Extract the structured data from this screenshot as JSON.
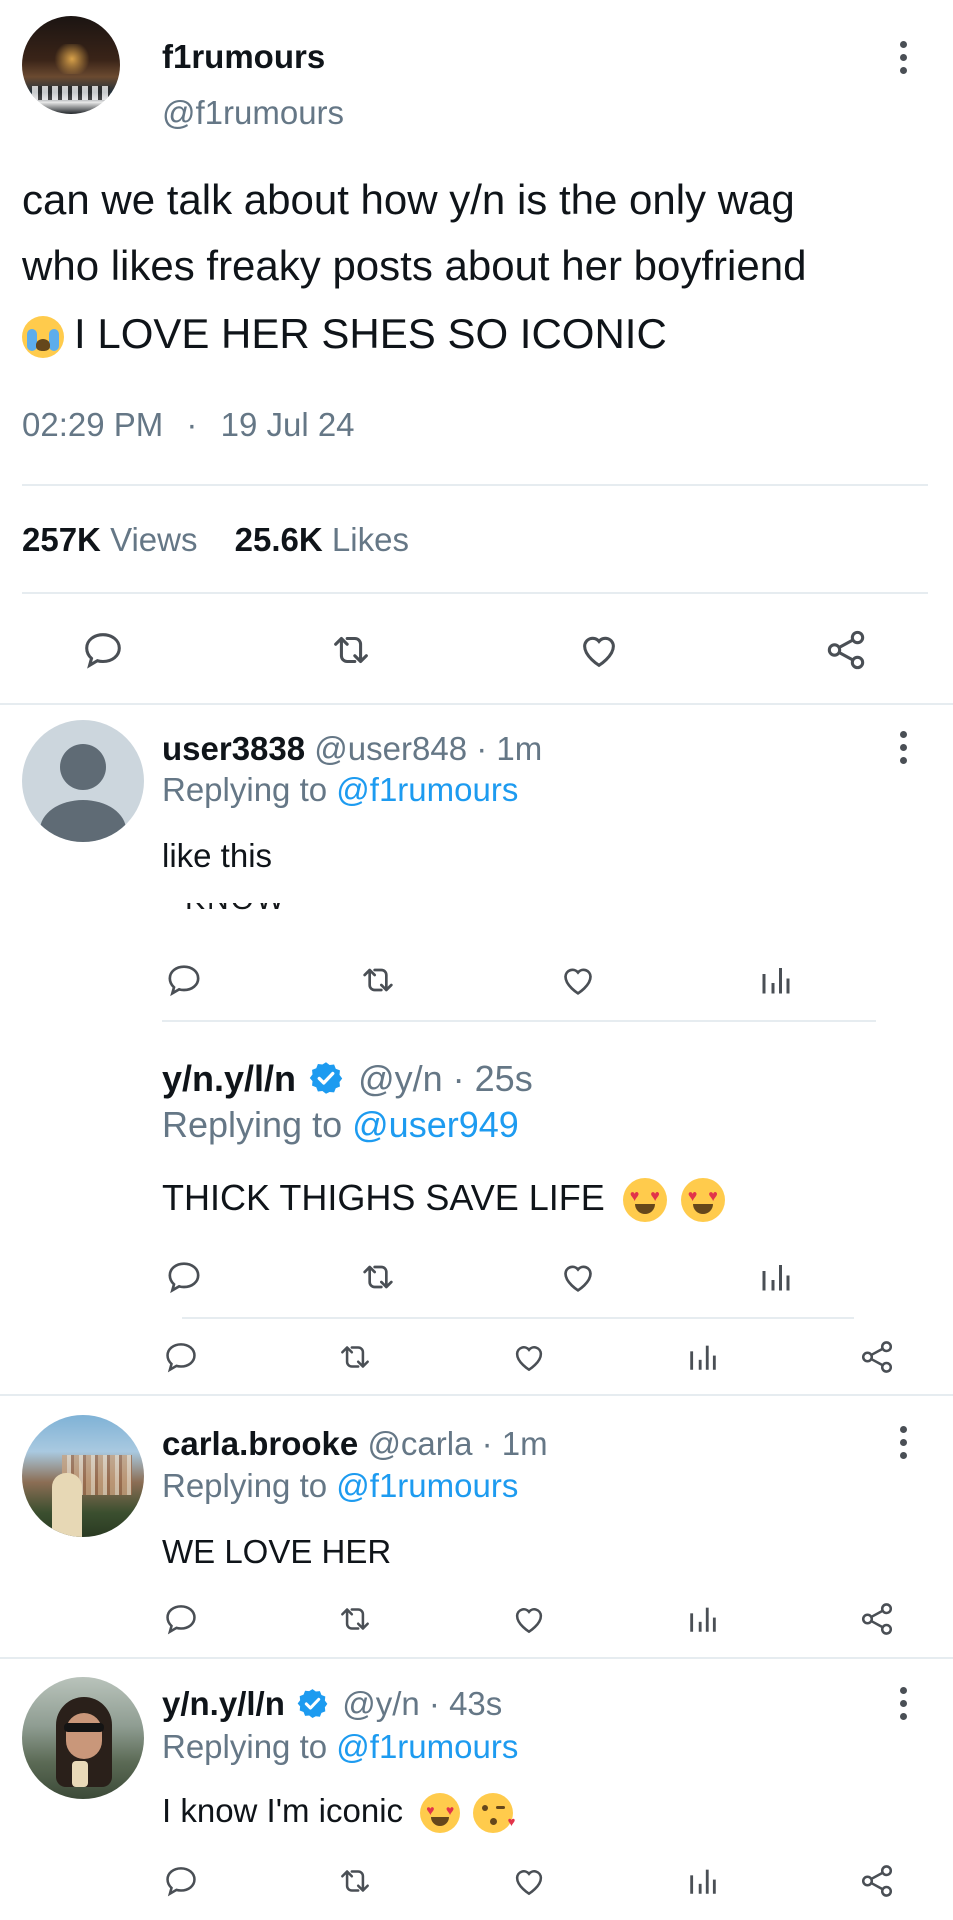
{
  "main_tweet": {
    "display_name": "f1rumours",
    "handle": "@f1rumours",
    "text_line1": "can we talk about how y/n is the only wag",
    "text_line2": "who likes freaky posts about her boyfriend",
    "text_line3": "I LOVE HER SHES SO ICONIC",
    "time": "02:29 PM",
    "separator": "·",
    "date": "19 Jul 24",
    "views_count": "257K",
    "views_label": "Views",
    "likes_count": "25.6K",
    "likes_label": "Likes"
  },
  "replies": [
    {
      "display_name": "user3838",
      "handle": "@user848",
      "meta": "· 1m",
      "replying_prefix": "Replying to",
      "replying_to": "@f1rumours",
      "text": "like this",
      "media_fragment": "KNOW"
    },
    {
      "display_name": "y/n.y/l/n",
      "handle": "@y/n",
      "meta": "· 25s",
      "replying_prefix": "Replying to",
      "replying_to": "@user949",
      "text": "THICK THIGHS SAVE LIFE"
    },
    {
      "display_name": "carla.brooke",
      "handle": "@carla",
      "meta": "· 1m",
      "replying_prefix": "Replying to",
      "replying_to": "@f1rumours",
      "text": "WE LOVE HER"
    },
    {
      "display_name": "y/n.y/l/n",
      "handle": "@y/n",
      "meta": "· 43s",
      "replying_prefix": "Replying to",
      "replying_to": "@f1rumours",
      "text": "I know I'm iconic"
    }
  ],
  "colors": {
    "link": "#1d9bf0",
    "muted": "#657786",
    "divider": "#e6ecf0",
    "verified": "#1d9bf0"
  },
  "icons": [
    "reply-icon",
    "retweet-icon",
    "like-icon",
    "share-icon",
    "analytics-icon",
    "more-icon",
    "verified-icon",
    "crying-face-emoji",
    "heart-eyes-emoji",
    "kissing-face-emoji"
  ]
}
